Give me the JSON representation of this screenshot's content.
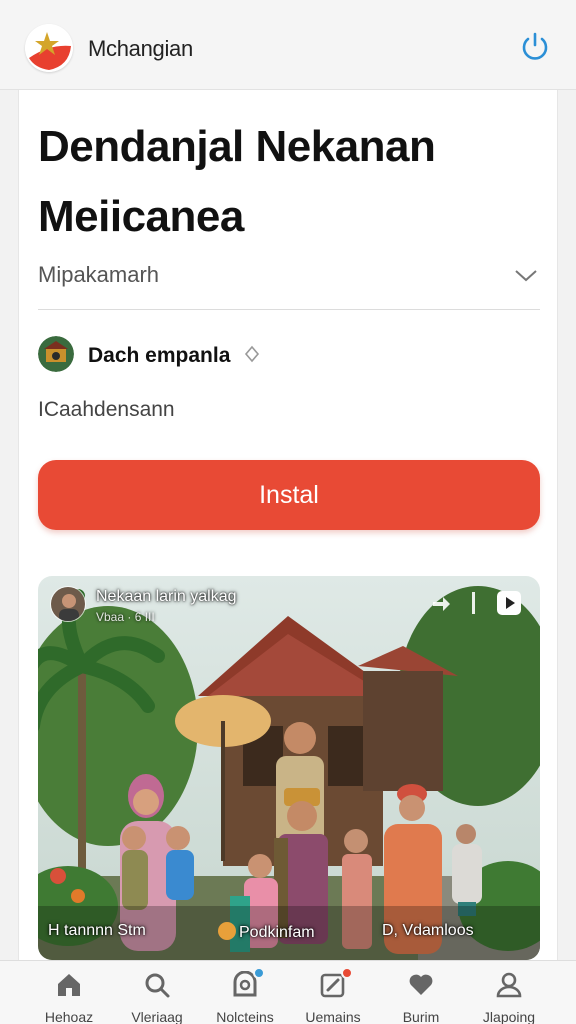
{
  "header": {
    "app_title": "Mchangian",
    "logo_icon": "star-logo-icon",
    "refresh_icon": "refresh-icon"
  },
  "article": {
    "title_line1": "Dendanjal Nekanan",
    "title_line2": "Meiicanea",
    "category_label": "Mipakamarh",
    "author_name": "Dach empanla",
    "subtext": "ICaahdensann",
    "install_label": "Instal"
  },
  "media": {
    "title": "Nekaan larin yalkag",
    "meta": "Vbaa  ·  6 III",
    "captions": {
      "left": "H tannnn Stm",
      "center": "Podkinfam",
      "right": "D, Vdamloos"
    }
  },
  "nav": {
    "items": [
      {
        "label": "Hehoaz",
        "icon": "home-icon"
      },
      {
        "label": "Vleriaag",
        "icon": "search-icon"
      },
      {
        "label": "Nolcteins",
        "icon": "notifications-icon"
      },
      {
        "label": "Uemains",
        "icon": "edit-icon"
      },
      {
        "label": "Burim",
        "icon": "heart-icon"
      },
      {
        "label": "Jlapoing",
        "icon": "profile-icon"
      }
    ]
  },
  "colors": {
    "accent": "#e84a35",
    "refresh": "#2b8fd6"
  }
}
